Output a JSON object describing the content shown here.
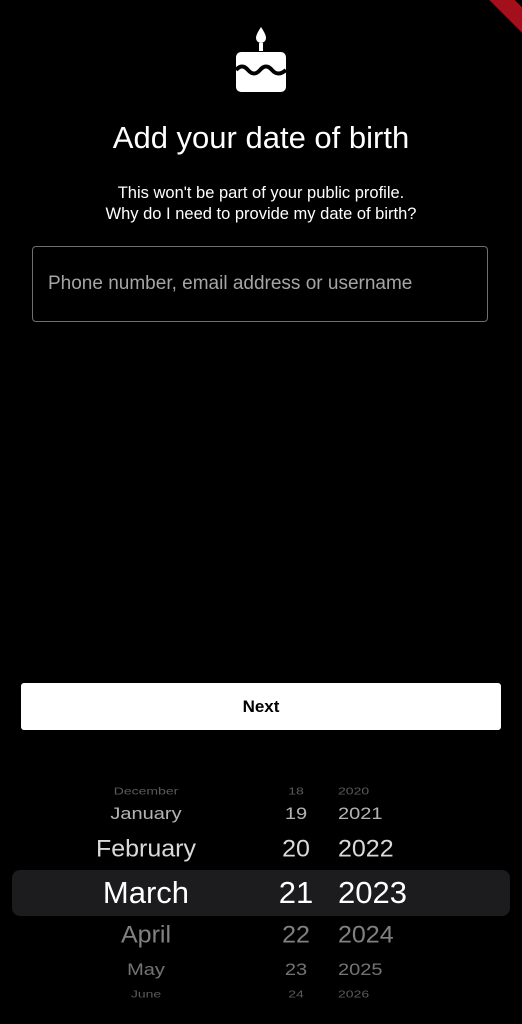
{
  "header": {
    "icon": "cake-icon",
    "title": "Add your date of birth",
    "subtitle_line1": "This won't be part of your public profile.",
    "subtitle_line2": "Why do I need to provide my date of birth?"
  },
  "form": {
    "input_placeholder": "Phone number, email address or username"
  },
  "actions": {
    "next_label": "Next"
  },
  "date_picker": {
    "months": [
      "December",
      "January",
      "February",
      "March",
      "April",
      "May",
      "June"
    ],
    "days": [
      "18",
      "19",
      "20",
      "21",
      "22",
      "23",
      "24"
    ],
    "years": [
      "2020",
      "2021",
      "2022",
      "2023",
      "2024",
      "2025",
      "2026"
    ],
    "selected": {
      "month": "March",
      "day": "21",
      "year": "2023"
    }
  },
  "colors": {
    "background": "#000000",
    "button_bg": "#ffffff",
    "picker_highlight": "#1c1c1e",
    "debug_banner": "#a30f1a"
  }
}
